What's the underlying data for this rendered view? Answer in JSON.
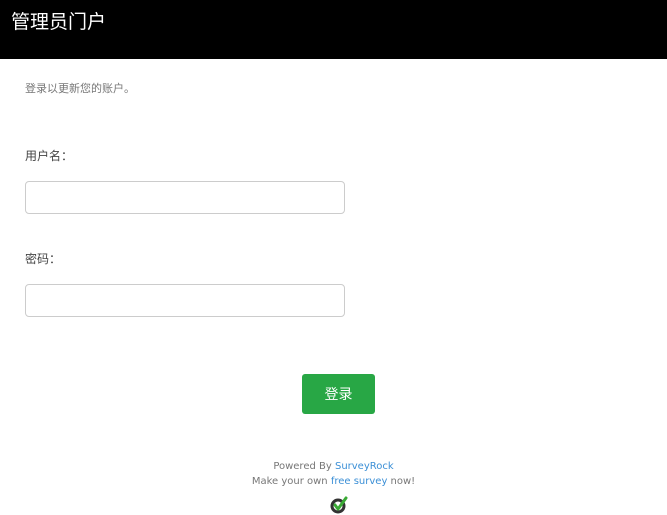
{
  "header": {
    "title": "管理员门户"
  },
  "form": {
    "intro": "登录以更新您的账户。",
    "username_label": "用户名：",
    "username_value": "",
    "password_label": "密码：",
    "password_value": "",
    "login_label": "登录"
  },
  "footer": {
    "powered_by": "Powered By ",
    "brand_link": "SurveyRock",
    "make_prefix": "Make your own ",
    "free_survey_link": "free survey",
    "make_suffix": " now!"
  },
  "colors": {
    "header_bg": "#000000",
    "button_bg": "#28a745",
    "link": "#3b8fd6",
    "logo_dark": "#333333",
    "logo_green": "#3aaa35"
  },
  "icons": {
    "logo": "surveyrock-logo-icon"
  }
}
